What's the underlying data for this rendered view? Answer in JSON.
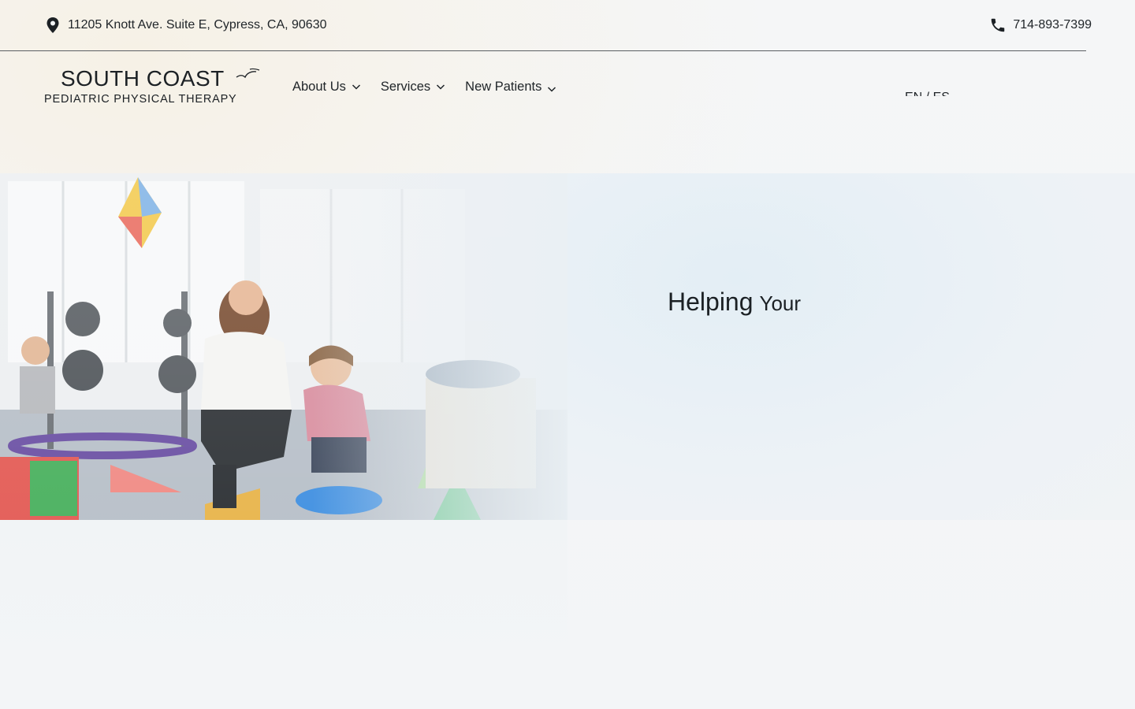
{
  "topbar": {
    "address": "11205 Knott Ave. Suite E, Cypress, CA, 90630",
    "phone": "714-893-7399",
    "pin_icon": "map-pin-icon",
    "phone_icon": "phone-icon"
  },
  "logo": {
    "line1": "SOUTH COAST",
    "line2": "PEDIATRIC PHYSICAL THERAPY",
    "mark_icon": "bird-icon"
  },
  "nav": {
    "items": [
      {
        "label": "About Us"
      },
      {
        "label": "Services"
      },
      {
        "label": "New Patients"
      }
    ]
  },
  "lang": {
    "label": "EN / ES"
  },
  "hero": {
    "heading_word1": "Helping",
    "heading_word2": "Your"
  },
  "colors": {
    "text": "#1d2226",
    "page_bg": "#f4f6f8",
    "rule": "#5b5f63"
  }
}
